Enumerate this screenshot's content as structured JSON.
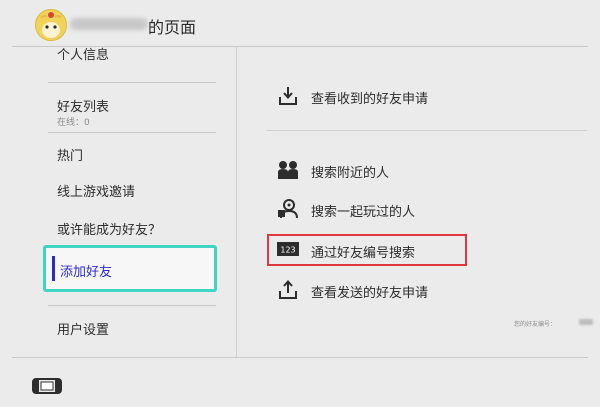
{
  "header": {
    "title": "的页面",
    "avatar_icon": "villager-avatar-icon"
  },
  "sidebar": {
    "items": [
      {
        "label": "个人信息"
      },
      {
        "label": "好友列表",
        "sub": "在线：0"
      },
      {
        "label": "热门"
      },
      {
        "label": "线上游戏邀请"
      },
      {
        "label": "或许能成为好友？"
      },
      {
        "label": "添加好友",
        "selected": true
      },
      {
        "label": "用户设置"
      }
    ]
  },
  "main": {
    "options": [
      {
        "label": "查看收到的好友申请",
        "icon": "inbox-download-icon"
      },
      {
        "label": "搜索附近的人",
        "icon": "nearby-users-icon"
      },
      {
        "label": "搜索一起玩过的人",
        "icon": "played-with-user-icon"
      },
      {
        "label": "通过好友编号搜索",
        "icon": "friend-code-123-icon",
        "highlighted": true
      },
      {
        "label": "查看发送的好友申请",
        "icon": "outbox-upload-icon"
      }
    ],
    "friend_code_label": "您的好友编号："
  },
  "footer": {
    "console_icon": "switch-console-icon"
  },
  "colors": {
    "background": "#ebebeb",
    "selection_border": "#40d4c2",
    "selected_text": "#2a2ad0",
    "highlight_border": "#e0373c"
  }
}
